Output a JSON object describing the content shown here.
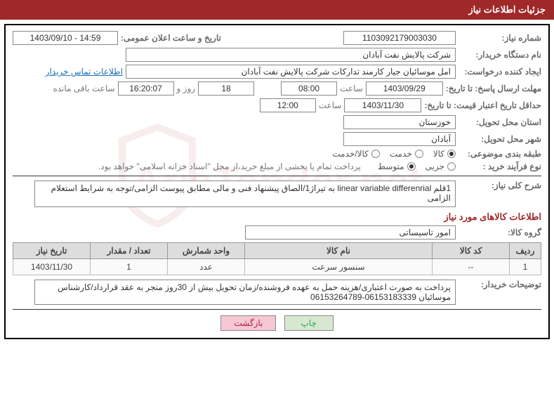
{
  "header": {
    "title": "جزئیات اطلاعات نیاز"
  },
  "fields": {
    "need_no_label": "شماره نیاز:",
    "need_no": "1103092179003030",
    "announce_label": "تاریخ و ساعت اعلان عمومی:",
    "announce": "1403/09/10 - 14:59",
    "buyer_org_label": "نام دستگاه خریدار:",
    "buyer_org": "شرکت پالایش نفت آبادان",
    "requester_label": "ایجاد کننده درخواست:",
    "requester": "امل موسائیان جیار کارمند تدارکات شرکت پالایش نفت آبادان",
    "contact_link": "اطلاعات تماس خریدار",
    "deadline_label": "مهلت ارسال پاسخ: تا تاریخ:",
    "deadline_date": "1403/09/29",
    "time_word": "ساعت",
    "deadline_time": "08:00",
    "days_count": "18",
    "days_word": "روز و",
    "countdown": "16:20:07",
    "remaining": "ساعت باقی مانده",
    "validity_label": "حداقل تاریخ اعتبار قیمت: تا تاریخ:",
    "validity_date": "1403/11/30",
    "validity_time": "12:00",
    "province_label": "استان محل تحویل:",
    "province": "خوزستان",
    "city_label": "شهر محل تحویل:",
    "city": "آبادان",
    "category_label": "طبقه بندی موضوعی:",
    "cat_opts": [
      "کالا",
      "خدمت",
      "کالا/خدمت"
    ],
    "cat_selected": 0,
    "purchase_type_label": "نوع فرآیند خرید :",
    "pt_opts": [
      "جزیی",
      "متوسط"
    ],
    "pt_selected": 1,
    "purchase_note": "پرداخت تمام یا بخشی از مبلغ خرید،از محل \"اسناد خزانه اسلامی\" خواهد بود.",
    "summary_label": "شرح کلی نیاز:",
    "summary": "1قلم linear variable differenrial به تیراژ1/الصاق پیشنهاد فنی و مالی مطابق پیوست الزامی/توجه به شرایط استعلام الزامی",
    "items_title": "اطلاعات کالاهای مورد نیاز",
    "group_label": "گروه کالا:",
    "group": "امور تاسیساتی",
    "buyer_notes_label": "توضیحات خریدار:",
    "buyer_notes": "پرداخت به صورت اعتباری/هزینه حمل به عهده فروشنده/زمان تحویل بیش از 30روز منجر به عقد قرارداد/کارشناس موسائیان 06153183339-06153264789"
  },
  "table": {
    "headers": [
      "ردیف",
      "کد کالا",
      "نام کالا",
      "واحد شمارش",
      "تعداد / مقدار",
      "تاریخ نیاز"
    ],
    "rows": [
      {
        "idx": "1",
        "code": "--",
        "name": "سنسور سرعت",
        "unit": "عدد",
        "qty": "1",
        "date": "1403/11/30"
      }
    ]
  },
  "buttons": {
    "print": "چاپ",
    "back": "بازگشت"
  },
  "watermark": "AriaTender.net"
}
